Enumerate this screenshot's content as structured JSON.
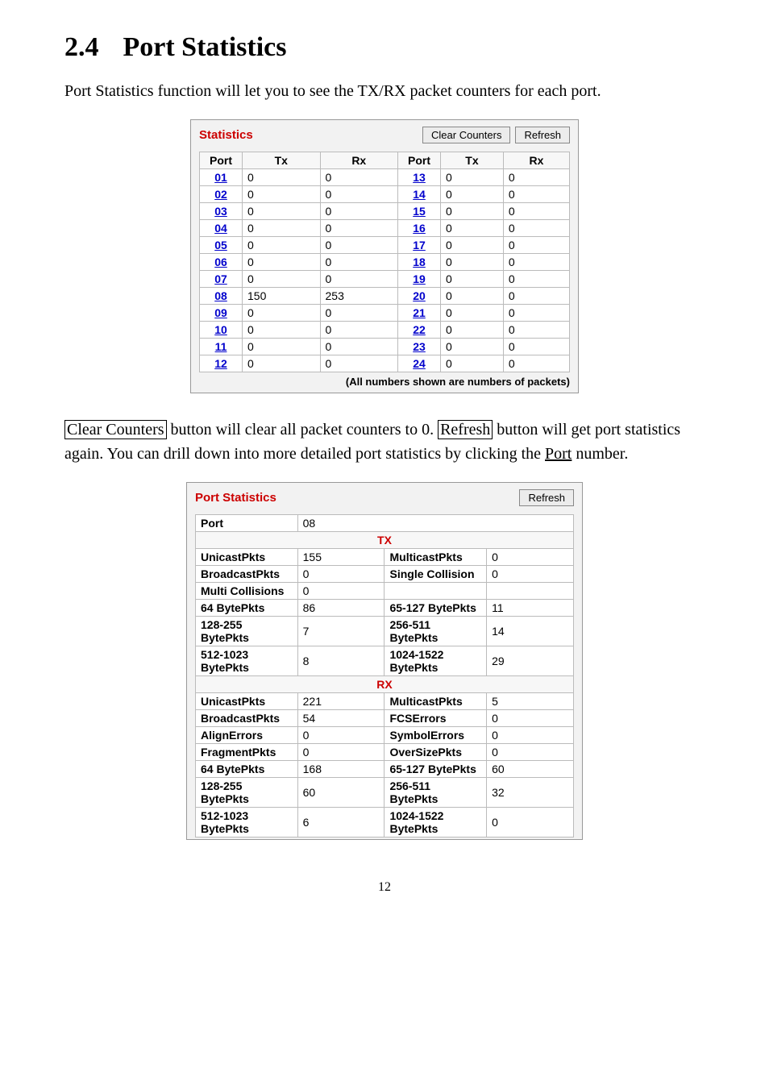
{
  "heading_number": "2.4",
  "heading_title": "Port Statistics",
  "intro_text": "Port Statistics function will let you to see the TX/RX packet counters for each port.",
  "stats_panel": {
    "title": "Statistics",
    "btn_clear": "Clear Counters",
    "btn_refresh": "Refresh",
    "headers": {
      "port": "Port",
      "tx": "Tx",
      "rx": "Rx"
    },
    "footnote": "(All numbers shown are numbers of packets)",
    "rows": [
      {
        "p1": "01",
        "tx1": "0",
        "rx1": "0",
        "p2": "13",
        "tx2": "0",
        "rx2": "0"
      },
      {
        "p1": "02",
        "tx1": "0",
        "rx1": "0",
        "p2": "14",
        "tx2": "0",
        "rx2": "0"
      },
      {
        "p1": "03",
        "tx1": "0",
        "rx1": "0",
        "p2": "15",
        "tx2": "0",
        "rx2": "0"
      },
      {
        "p1": "04",
        "tx1": "0",
        "rx1": "0",
        "p2": "16",
        "tx2": "0",
        "rx2": "0"
      },
      {
        "p1": "05",
        "tx1": "0",
        "rx1": "0",
        "p2": "17",
        "tx2": "0",
        "rx2": "0"
      },
      {
        "p1": "06",
        "tx1": "0",
        "rx1": "0",
        "p2": "18",
        "tx2": "0",
        "rx2": "0"
      },
      {
        "p1": "07",
        "tx1": "0",
        "rx1": "0",
        "p2": "19",
        "tx2": "0",
        "rx2": "0"
      },
      {
        "p1": "08",
        "tx1": "150",
        "rx1": "253",
        "p2": "20",
        "tx2": "0",
        "rx2": "0"
      },
      {
        "p1": "09",
        "tx1": "0",
        "rx1": "0",
        "p2": "21",
        "tx2": "0",
        "rx2": "0"
      },
      {
        "p1": "10",
        "tx1": "0",
        "rx1": "0",
        "p2": "22",
        "tx2": "0",
        "rx2": "0"
      },
      {
        "p1": "11",
        "tx1": "0",
        "rx1": "0",
        "p2": "23",
        "tx2": "0",
        "rx2": "0"
      },
      {
        "p1": "12",
        "tx1": "0",
        "rx1": "0",
        "p2": "24",
        "tx2": "0",
        "rx2": "0"
      }
    ]
  },
  "mid_para": {
    "clear_label": "Clear Counters",
    "frag1": " button will clear all packet counters to 0. ",
    "refresh_label": "Refresh",
    "frag2": " button will get port statistics again. You can drill down into more detailed port statistics by clicking the ",
    "port_label": "Port",
    "frag3": " number."
  },
  "details_panel": {
    "title": "Port Statistics",
    "btn_refresh": "Refresh",
    "port_label": "Port",
    "port_value": "08",
    "tx_header": "TX",
    "rx_header": "RX",
    "tx_rows": [
      {
        "l1": "UnicastPkts",
        "v1": "155",
        "l2": "MulticastPkts",
        "v2": "0"
      },
      {
        "l1": "BroadcastPkts",
        "v1": "0",
        "l2": "Single Collision",
        "v2": "0"
      },
      {
        "l1": "Multi Collisions",
        "v1": "0",
        "l2": "",
        "v2": ""
      },
      {
        "l1": "64 BytePkts",
        "v1": "86",
        "l2": "65-127 BytePkts",
        "v2": "11"
      },
      {
        "l1": "128-255 BytePkts",
        "v1": "7",
        "l2": "256-511 BytePkts",
        "v2": "14"
      },
      {
        "l1": "512-1023 BytePkts",
        "v1": "8",
        "l2": "1024-1522 BytePkts",
        "v2": "29"
      }
    ],
    "rx_rows": [
      {
        "l1": "UnicastPkts",
        "v1": "221",
        "l2": "MulticastPkts",
        "v2": "5"
      },
      {
        "l1": "BroadcastPkts",
        "v1": "54",
        "l2": "FCSErrors",
        "v2": "0"
      },
      {
        "l1": "AlignErrors",
        "v1": "0",
        "l2": "SymbolErrors",
        "v2": "0"
      },
      {
        "l1": "FragmentPkts",
        "v1": "0",
        "l2": "OverSizePkts",
        "v2": "0"
      },
      {
        "l1": "64 BytePkts",
        "v1": "168",
        "l2": "65-127 BytePkts",
        "v2": "60"
      },
      {
        "l1": "128-255 BytePkts",
        "v1": "60",
        "l2": "256-511 BytePkts",
        "v2": "32"
      },
      {
        "l1": "512-1023 BytePkts",
        "v1": "6",
        "l2": "1024-1522 BytePkts",
        "v2": "0"
      }
    ]
  },
  "page_number": "12"
}
